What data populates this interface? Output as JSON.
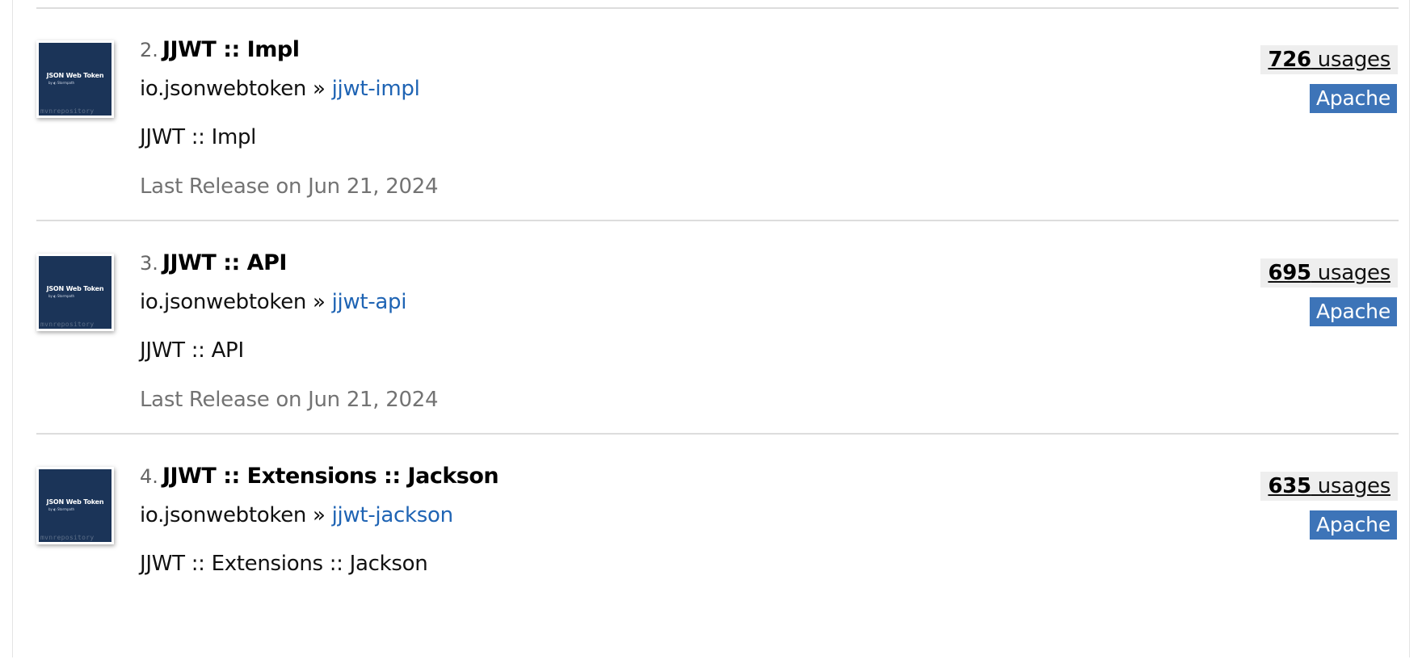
{
  "results": [
    {
      "index": "2.",
      "title": "JJWT :: Impl",
      "group": "io.jsonwebtoken",
      "separator": " » ",
      "artifact": "jjwt-impl",
      "description": "JJWT :: Impl",
      "release": "Last Release on Jun 21, 2024",
      "usage_count": "726",
      "usage_label": " usages",
      "license": "Apache",
      "logo_title": "JSON Web Token",
      "logo_sub": "by ◐ Stormpath",
      "logo_watermark": "mvnrepository"
    },
    {
      "index": "3.",
      "title": "JJWT :: API",
      "group": "io.jsonwebtoken",
      "separator": " » ",
      "artifact": "jjwt-api",
      "description": "JJWT :: API",
      "release": "Last Release on Jun 21, 2024",
      "usage_count": "695",
      "usage_label": " usages",
      "license": "Apache",
      "logo_title": "JSON Web Token",
      "logo_sub": "by ◐ Stormpath",
      "logo_watermark": "mvnrepository"
    },
    {
      "index": "4.",
      "title": "JJWT :: Extensions :: Jackson",
      "group": "io.jsonwebtoken",
      "separator": " » ",
      "artifact": "jjwt-jackson",
      "description": "JJWT :: Extensions :: Jackson",
      "release": "",
      "usage_count": "635",
      "usage_label": " usages",
      "license": "Apache",
      "logo_title": "JSON Web Token",
      "logo_sub": "by ◐ Stormpath",
      "logo_watermark": "mvnrepository"
    }
  ],
  "colors": {
    "link": "#1f64b4",
    "license_badge": "#3d74b8",
    "usage_badge_bg": "#eeeeee",
    "logo_bg": "#1b3458",
    "muted_text": "#737373"
  }
}
